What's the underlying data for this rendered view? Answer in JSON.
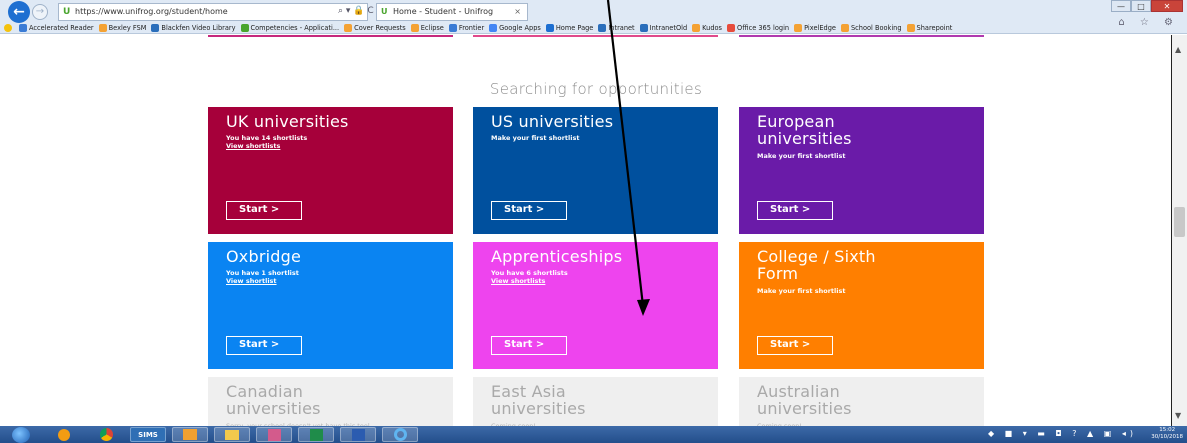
{
  "browser": {
    "url": "https://www.unifrog.org/student/home",
    "tab_title": "Home - Student - Unifrog",
    "tab_close": "×",
    "address_icons": "⌕ ▾ 🔒 C",
    "window_controls": {
      "minimize": "—",
      "maximize": "□",
      "close": "✕"
    },
    "tool_icons": "⌂ ☆ ⚙"
  },
  "favorites": [
    {
      "label": "Accelerated Reader",
      "color": "#3a7bd5"
    },
    {
      "label": "Bexley FSM",
      "color": "#f4a234"
    },
    {
      "label": "Blackfen Video Library",
      "color": "#2a6ebb"
    },
    {
      "label": "Competencies - Applicati...",
      "color": "#4aa52e"
    },
    {
      "label": "Cover Requests",
      "color": "#f4a234"
    },
    {
      "label": "Eclipse",
      "color": "#f4a234"
    },
    {
      "label": "Frontier",
      "color": "#3a7bd5"
    },
    {
      "label": "Google Apps",
      "color": "#4285f4"
    },
    {
      "label": "Home Page",
      "color": "#1e6fd1"
    },
    {
      "label": "Intranet",
      "color": "#2a6ebb"
    },
    {
      "label": "IntranetOld",
      "color": "#2a6ebb"
    },
    {
      "label": "Kudos",
      "color": "#f4a234"
    },
    {
      "label": "Office 365 login",
      "color": "#e74c3c"
    },
    {
      "label": "PixelEdge",
      "color": "#f4a234"
    },
    {
      "label": "School Booking",
      "color": "#f4a234"
    },
    {
      "label": "Sharepoint",
      "color": "#f4a234"
    }
  ],
  "page": {
    "section_title": "Searching for opportunities",
    "start_label": "Start  >",
    "tiles": [
      {
        "title": "UK universities",
        "subtitle": "You have 14 shortlists",
        "link": "View shortlists",
        "color": "#a6003a"
      },
      {
        "title": "US universities",
        "subtitle": "Make your first shortlist",
        "link": "",
        "color": "#00509e"
      },
      {
        "title": "European universities",
        "subtitle": "Make your first shortlist",
        "link": "",
        "color": "#6a1ba8"
      },
      {
        "title": "Oxbridge",
        "subtitle": "You have 1 shortlist",
        "link": "View shortlist",
        "color": "#0a84f2"
      },
      {
        "title": "Apprenticeships",
        "subtitle": "You have 6 shortlists",
        "link": "View shortlists",
        "color": "#ee44ee"
      },
      {
        "title": "College / Sixth Form",
        "subtitle": "Make your first shortlist",
        "link": "",
        "color": "#ff7f00"
      },
      {
        "title": "Canadian universities",
        "subtitle": "Sorry, your school doesn't yet have this tool",
        "link": "",
        "color": "#efefef"
      },
      {
        "title": "East Asia universities",
        "subtitle": "Coming soon!",
        "link": "",
        "color": "#efefef"
      },
      {
        "title": "Australian universities",
        "subtitle": "Coming soon!",
        "link": "",
        "color": "#efefef"
      }
    ]
  },
  "taskbar": {
    "sims_label": "SIMS",
    "clock_time": "15:02",
    "clock_date": "30/10/2018"
  }
}
